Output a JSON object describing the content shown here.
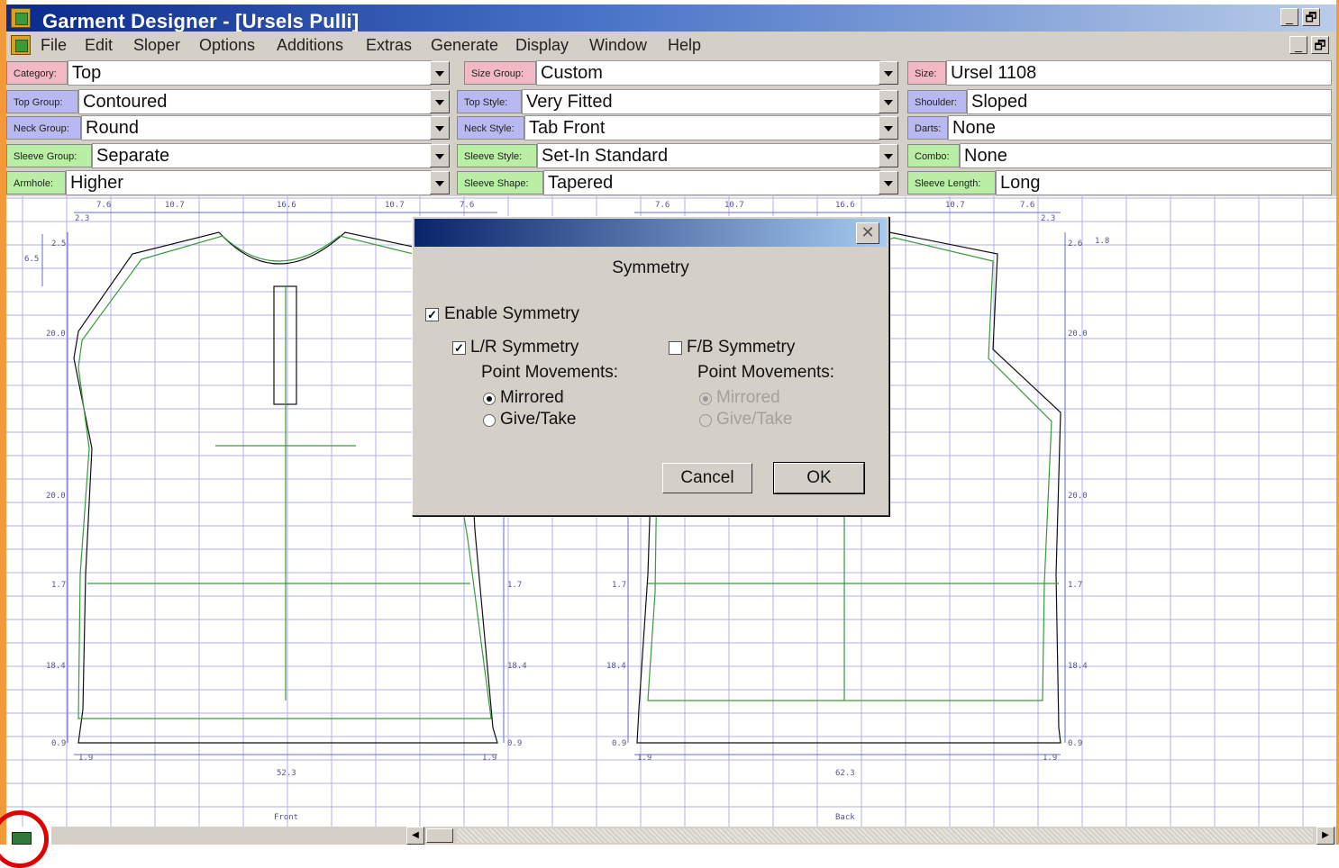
{
  "window": {
    "title": "Garment Designer - [Ursels Pulli]",
    "minimize": "_",
    "restore": "🗗"
  },
  "menu": [
    "File",
    "Edit",
    "Sloper",
    "Options",
    "Additions",
    "Extras",
    "Generate",
    "Display",
    "Window",
    "Help"
  ],
  "properties": {
    "category": {
      "label": "Category:",
      "value": "Top"
    },
    "size_group": {
      "label": "Size Group:",
      "value": "Custom"
    },
    "size": {
      "label": "Size:",
      "value": "Ursel 1108"
    },
    "top_group": {
      "label": "Top Group:",
      "value": "Contoured"
    },
    "top_style": {
      "label": "Top Style:",
      "value": "Very Fitted"
    },
    "shoulder": {
      "label": "Shoulder:",
      "value": "Sloped"
    },
    "neck_group": {
      "label": "Neck Group:",
      "value": "Round"
    },
    "neck_style": {
      "label": "Neck Style:",
      "value": "Tab Front"
    },
    "darts": {
      "label": "Darts:",
      "value": "None"
    },
    "sleeve_group": {
      "label": "Sleeve Group:",
      "value": "Separate"
    },
    "sleeve_style": {
      "label": "Sleeve Style:",
      "value": "Set-In Standard"
    },
    "combo": {
      "label": "Combo:",
      "value": "None"
    },
    "armhole": {
      "label": "Armhole:",
      "value": "Higher"
    },
    "sleeve_shape": {
      "label": "Sleeve Shape:",
      "value": "Tapered"
    },
    "sleeve_length": {
      "label": "Sleeve Length:",
      "value": "Long"
    }
  },
  "pattern": {
    "front_label": "Front",
    "back_label": "Back",
    "front_width": "52.3",
    "back_width": "62.3",
    "top_dims": [
      "7.6",
      "10.7",
      "16.6",
      "10.7",
      "7.6",
      "7.6",
      "10.7",
      "16.6",
      "10.7",
      "7.6"
    ],
    "left_dims": [
      "6.5",
      "2.5",
      "20.0",
      "20.0",
      "1.7",
      "18.4",
      "0.9"
    ],
    "mid_dims": [
      "1.7",
      "18.4",
      "0.9",
      "1.7",
      "18.4",
      "0.9"
    ],
    "right_dims": [
      "2.6",
      "1.8",
      "20.0",
      "20.0",
      "1.7",
      "18.4",
      "0.9"
    ],
    "hem_dims": [
      "1.9",
      "1.9",
      "1.9",
      "1.9"
    ],
    "neck_dims": [
      "2.3",
      "2.3"
    ]
  },
  "dialog": {
    "title": "Symmetry",
    "enable_symmetry": {
      "label": "Enable Symmetry",
      "checked": true
    },
    "lr_symmetry": {
      "label": "L/R Symmetry",
      "checked": true
    },
    "fb_symmetry": {
      "label": "F/B Symmetry",
      "checked": false
    },
    "point_movements_label": "Point Movements:",
    "lr_options": [
      {
        "label": "Mirrored",
        "selected": true
      },
      {
        "label": "Give/Take",
        "selected": false
      }
    ],
    "fb_options": [
      {
        "label": "Mirrored",
        "selected": true,
        "disabled": true
      },
      {
        "label": "Give/Take",
        "selected": false,
        "disabled": true
      }
    ],
    "cancel": "Cancel",
    "ok": "OK"
  },
  "colors": {
    "grid": "#aeb0ee",
    "pattern_line": "#111111",
    "pattern_alt": "#3a9a3a",
    "accent_orange": "#f29a3a"
  }
}
